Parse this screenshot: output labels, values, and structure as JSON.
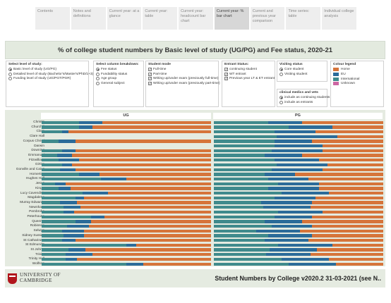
{
  "tabs": [
    {
      "label": "Contents"
    },
    {
      "label": "Notes and definitions"
    },
    {
      "label": "Current year: at a glance"
    },
    {
      "label": "Current year: table"
    },
    {
      "label": "Current year: headcount bar chart"
    },
    {
      "label": "Current year: % bar chart"
    },
    {
      "label": "Current and previous year comparison"
    },
    {
      "label": "Time series: table"
    },
    {
      "label": "Individual college analysis"
    }
  ],
  "header": {
    "title": "% of college student numbers by Basic level of study (UG/PG) and Fee status, 2020-21"
  },
  "filters": {
    "level": {
      "title": "Select level of study:",
      "options": [
        "Basic level of study (UG/PG)",
        "Detailed level of study (Bachelor's/Master's/PhD/1+3)",
        "Funding level of study (UG/PGT/PGR)"
      ]
    },
    "breakdown": {
      "title": "Select column breakdown:",
      "options": [
        "Fee status",
        "Fundability status",
        "Age group",
        "General subject"
      ]
    },
    "mode": {
      "title": "Student mode",
      "options": [
        "Full-time",
        "Part-time",
        "Writing up/under exam (previously full-time)",
        "Writing up/under exam (previously part-time)"
      ]
    },
    "entrant": {
      "title": "Entrant Status:",
      "options": [
        "continuing student",
        "WT entrant",
        "Previous year LT & ET entrant"
      ]
    },
    "visiting": {
      "title": "Visiting status",
      "options": [
        "Core student",
        "Visiting student"
      ]
    },
    "clinical": {
      "title": "clinical medics and vets",
      "options": [
        "include as continuing students",
        "include as entrants"
      ]
    }
  },
  "legend": {
    "title": "Colour legend",
    "items": [
      {
        "label": "Home",
        "color": "#d6743a"
      },
      {
        "label": "EU",
        "color": "#2b6b99"
      },
      {
        "label": "International",
        "color": "#3f8a8c"
      },
      {
        "label": "Unknown",
        "color": "#cc66a3"
      }
    ]
  },
  "chart_data": {
    "type": "bar",
    "columns": [
      "UG",
      "PG"
    ],
    "categories": [
      "Christ's",
      "Churchill",
      "Clare",
      "Clare Hall",
      "Corpus Christi",
      "Darwin",
      "Downing",
      "Emmanuel",
      "Fitzwilliam",
      "Girton",
      "Gonville and Caius",
      "Homerton",
      "Hughes Hall",
      "Jesus",
      "King's",
      "Lucy Cavendish",
      "Magdalene",
      "Murray Edwards",
      "Newnham",
      "Pembroke",
      "Peterhouse",
      "Queens'",
      "Robinson",
      "Selwyn",
      "Sidney Sussex",
      "St Catharine's",
      "St Edmund's",
      "St John's",
      "Trinity",
      "Trinity Hall",
      "Wolfson"
    ],
    "series_names": [
      "International",
      "EU",
      "Home"
    ],
    "ug": [
      [
        22,
        14,
        64
      ],
      [
        22,
        8,
        70
      ],
      [
        12,
        4,
        84
      ],
      [
        0,
        0,
        0
      ],
      [
        10,
        10,
        80
      ],
      [
        0,
        0,
        0
      ],
      [
        12,
        8,
        80
      ],
      [
        9,
        9,
        82
      ],
      [
        10,
        12,
        78
      ],
      [
        12,
        6,
        82
      ],
      [
        11,
        9,
        80
      ],
      [
        22,
        12,
        66
      ],
      [
        35,
        15,
        50
      ],
      [
        8,
        6,
        86
      ],
      [
        10,
        7,
        83
      ],
      [
        24,
        15,
        61
      ],
      [
        20,
        5,
        75
      ],
      [
        11,
        10,
        79
      ],
      [
        13,
        10,
        77
      ],
      [
        13,
        6,
        81
      ],
      [
        29,
        8,
        63
      ],
      [
        20,
        9,
        71
      ],
      [
        15,
        13,
        72
      ],
      [
        12,
        13,
        75
      ],
      [
        13,
        12,
        75
      ],
      [
        12,
        8,
        80
      ],
      [
        50,
        6,
        44
      ],
      [
        16,
        10,
        74
      ],
      [
        14,
        16,
        70
      ],
      [
        14,
        7,
        79
      ],
      [
        50,
        10,
        40
      ]
    ],
    "pg": [
      [
        32,
        20,
        48
      ],
      [
        44,
        26,
        30
      ],
      [
        36,
        24,
        40
      ],
      [
        37,
        36,
        27
      ],
      [
        36,
        22,
        42
      ],
      [
        36,
        28,
        36
      ],
      [
        34,
        30,
        36
      ],
      [
        30,
        22,
        48
      ],
      [
        36,
        26,
        38
      ],
      [
        37,
        30,
        33
      ],
      [
        34,
        30,
        36
      ],
      [
        30,
        18,
        52
      ],
      [
        32,
        24,
        44
      ],
      [
        38,
        24,
        38
      ],
      [
        32,
        30,
        38
      ],
      [
        40,
        28,
        32
      ],
      [
        36,
        24,
        40
      ],
      [
        28,
        30,
        42
      ],
      [
        29,
        28,
        43
      ],
      [
        38,
        26,
        36
      ],
      [
        36,
        22,
        42
      ],
      [
        30,
        22,
        48
      ],
      [
        34,
        24,
        42
      ],
      [
        25,
        26,
        49
      ],
      [
        32,
        26,
        42
      ],
      [
        30,
        26,
        44
      ],
      [
        38,
        32,
        30
      ],
      [
        33,
        28,
        39
      ],
      [
        31,
        26,
        43
      ],
      [
        40,
        28,
        32
      ],
      [
        44,
        28,
        28
      ]
    ],
    "xlim": [
      0,
      100
    ]
  },
  "footer": {
    "logo_line1": "UNIVERSITY OF",
    "logo_line2": "CAMBRIDGE",
    "title": "Student Numbers by College v2020.2 31-03-2021 (see N.."
  }
}
